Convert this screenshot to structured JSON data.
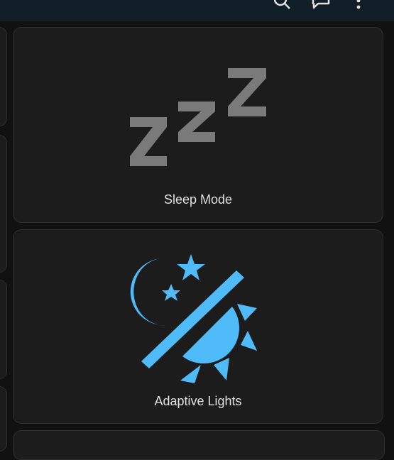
{
  "toolbar": {
    "icons": [
      "search-icon",
      "chat-icon",
      "more-vert-icon"
    ]
  },
  "cards": [
    {
      "label": "Sleep Mode",
      "icon": "sleep-zzz-icon",
      "icon_color": "#7a7a7a"
    },
    {
      "label": "Adaptive Lights",
      "icon": "adaptive-lights-icon",
      "icon_color": "#4fbbf9"
    }
  ],
  "colors": {
    "background": "#111111",
    "card": "#1c1c1c",
    "card_border": "#2e2e2e",
    "topbar": "#101e27",
    "label_text": "#e1e1e1",
    "accent": "#4fbbf9"
  }
}
